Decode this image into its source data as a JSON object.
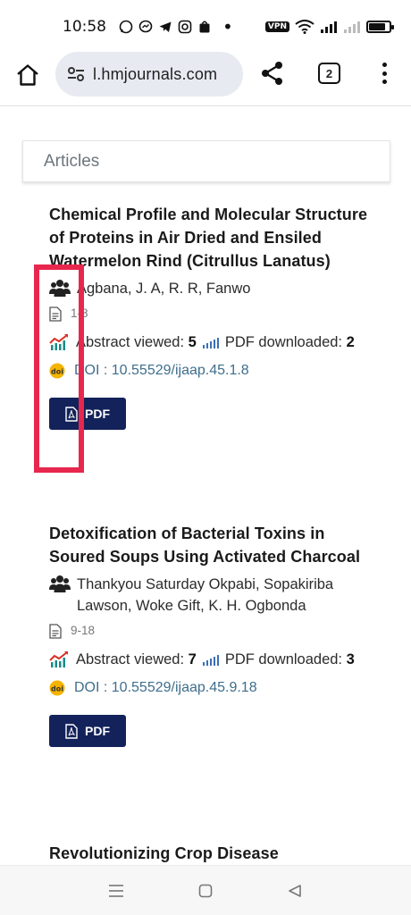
{
  "status_bar": {
    "time": "10:58",
    "vpn_label": "VPN",
    "notification_icons": [
      "whatsapp-icon",
      "messenger-icon",
      "telegram-icon",
      "instagram-icon",
      "shopping-icon"
    ]
  },
  "browser": {
    "url": "l.hmjournals.com",
    "tab_count": "2"
  },
  "section": {
    "title": "Articles"
  },
  "articles": [
    {
      "title": "Chemical Profile and Molecular Structure of Proteins in Air Dried and Ensiled Watermelon Rind (Citrullus Lanatus)",
      "authors": "Agbana, J. A, R. R, Fanwo",
      "pages": "1-8",
      "abstract_label": "Abstract viewed:",
      "abstract_count": "5",
      "pdf_label": "PDF downloaded:",
      "pdf_count": "2",
      "doi": "DOI : 10.55529/ijaap.45.1.8",
      "pdf_button": "PDF"
    },
    {
      "title": "Detoxification of Bacterial Toxins in Soured Soups Using Activated Charcoal",
      "authors": "Thankyou Saturday Okpabi, Sopakiriba Lawson, Woke Gift, K. H. Ogbonda",
      "pages": "9-18",
      "abstract_label": "Abstract viewed:",
      "abstract_count": "7",
      "pdf_label": "PDF downloaded:",
      "pdf_count": "3",
      "doi": "DOI : 10.55529/ijaap.45.9.18",
      "pdf_button": "PDF"
    },
    {
      "title": "Revolutionizing Crop Disease"
    }
  ],
  "colors": {
    "pdf_button_bg": "#13225a",
    "doi_link": "#3f6e8c",
    "highlight_border": "#e8274e",
    "section_title": "#6c757d"
  }
}
